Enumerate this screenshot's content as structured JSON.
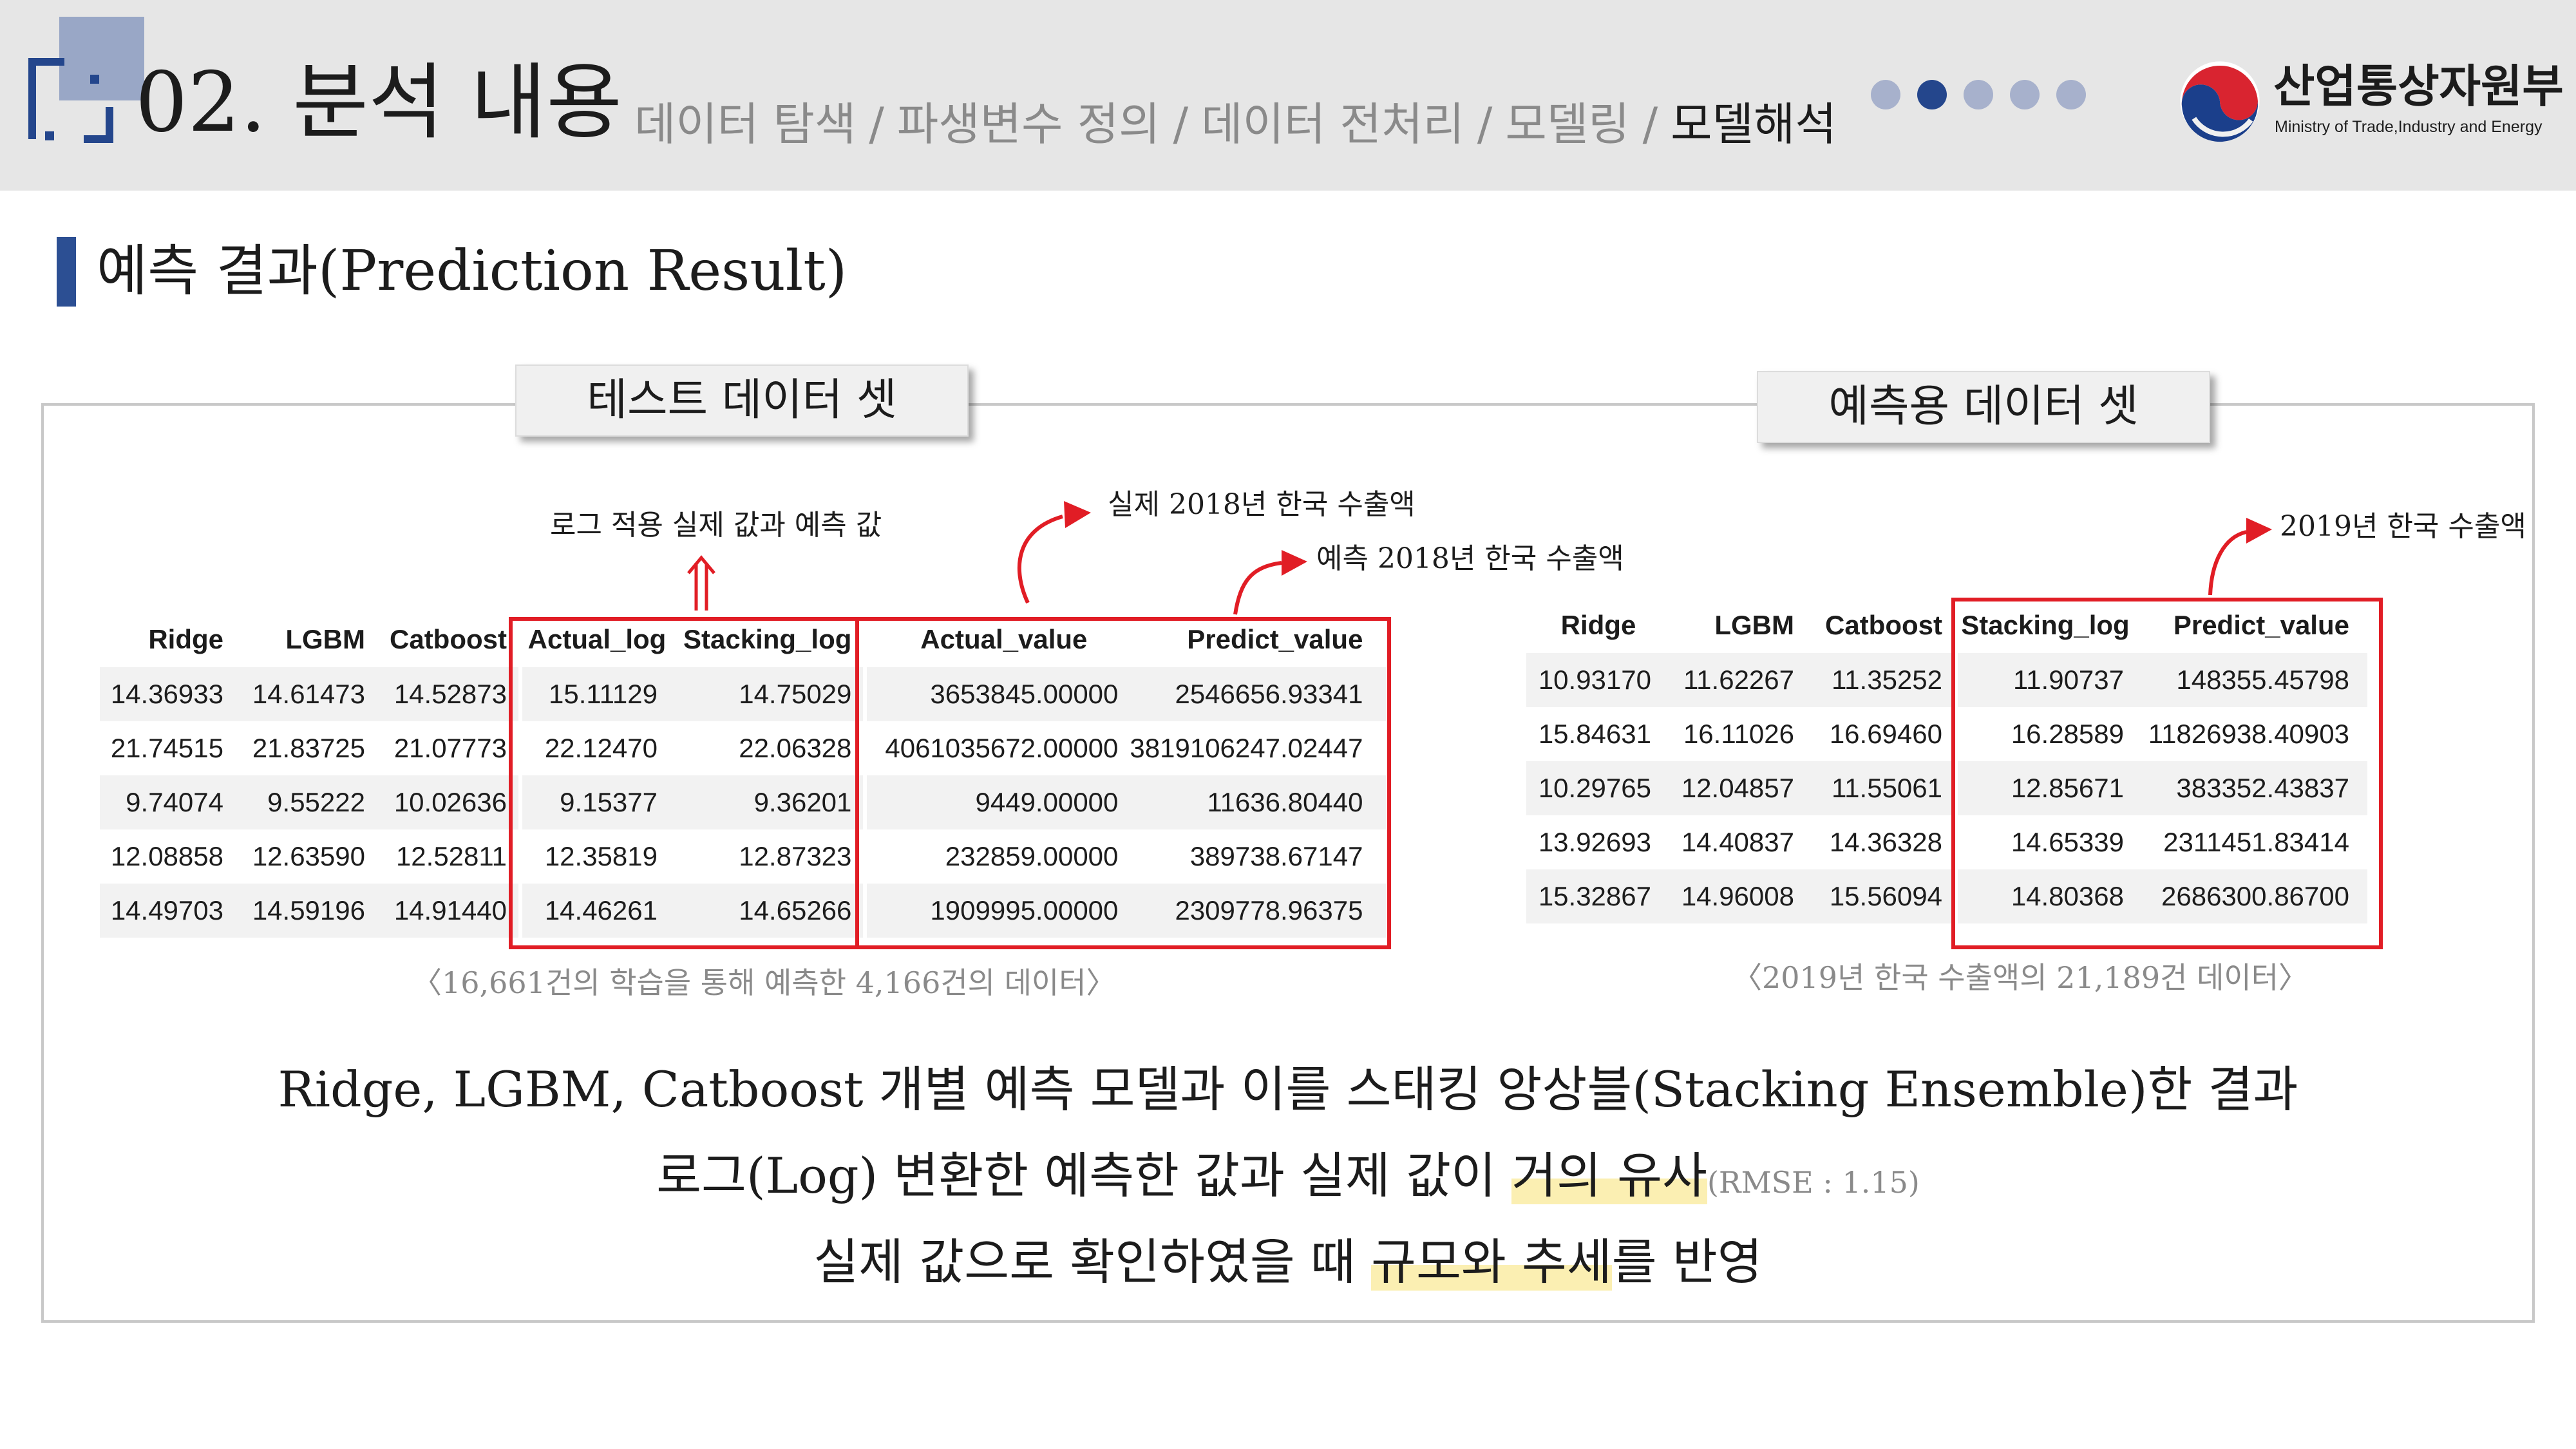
{
  "header": {
    "title": "02. 분석 내용",
    "nav": [
      "데이터 탐색",
      "파생변수 정의",
      "데이터 전처리",
      "모델링",
      "모델해석"
    ],
    "separator": "/",
    "active_index": 4,
    "dots": 5,
    "active_dot": 1,
    "logo_name": "산업통상자원부",
    "logo_sub": "Ministry of Trade,Industry and Energy",
    "colors": {
      "accent": "#24468c",
      "dot": "#a7b1cc",
      "header_bg": "#e6e6e6"
    }
  },
  "section": {
    "title": "예측 결과(Prediction Result)"
  },
  "left": {
    "label": "테스트 데이터 셋",
    "annot_log": "로그 적용 실제 값과 예측 값",
    "annot_actual": "실제 2018년 한국 수출액",
    "annot_pred": "예측 2018년 한국 수출액",
    "columns": [
      "Ridge",
      "LGBM",
      "Catboost",
      "Actual_log",
      "Stacking_log",
      "Actual_value",
      "Predict_value"
    ],
    "rows": [
      [
        "14.36933",
        "14.61473",
        "14.52873",
        "15.11129",
        "14.75029",
        "3653845.00000",
        "2546656.93341"
      ],
      [
        "21.74515",
        "21.83725",
        "21.07773",
        "22.12470",
        "22.06328",
        "4061035672.00000",
        "3819106247.02447"
      ],
      [
        "9.74074",
        "9.55222",
        "10.02636",
        "9.15377",
        "9.36201",
        "9449.00000",
        "11636.80440"
      ],
      [
        "12.08858",
        "12.63590",
        "12.52811",
        "12.35819",
        "12.87323",
        "232859.00000",
        "389738.67147"
      ],
      [
        "14.49703",
        "14.59196",
        "14.91440",
        "14.46261",
        "14.65266",
        "1909995.00000",
        "2309778.96375"
      ]
    ],
    "caption": "〈16,661건의 학습을 통해 예측한 4,166건의 데이터〉"
  },
  "right": {
    "label": "예측용 데이터 셋",
    "annot_2019": "2019년 한국 수출액",
    "columns": [
      "Ridge",
      "LGBM",
      "Catboost",
      "Stacking_log",
      "Predict_value"
    ],
    "rows": [
      [
        "10.93170",
        "11.62267",
        "11.35252",
        "11.90737",
        "148355.45798"
      ],
      [
        "15.84631",
        "16.11026",
        "16.69460",
        "16.28589",
        "11826938.40903"
      ],
      [
        "10.29765",
        "12.04857",
        "11.55061",
        "12.85671",
        "383352.43837"
      ],
      [
        "13.92693",
        "14.40837",
        "14.36328",
        "14.65339",
        "2311451.83414"
      ],
      [
        "15.32867",
        "14.96008",
        "15.56094",
        "14.80368",
        "2686300.86700"
      ]
    ],
    "caption": "〈2019년 한국 수출액의 21,189건 데이터〉"
  },
  "summary": {
    "line1": "Ridge, LGBM, Catboost 개별 예측 모델과 이를 스태킹 앙상블(Stacking Ensemble)한 결과",
    "line2_pre": "로그(Log) 변환한 예측한 값과 실제 값이 ",
    "line2_hl": "거의 유사",
    "line2_small": "(RMSE : 1.15)",
    "line3_pre": "실제 값으로 확인하였을 때 ",
    "line3_hl": "규모와 추세",
    "line3_post": "를 반영"
  }
}
